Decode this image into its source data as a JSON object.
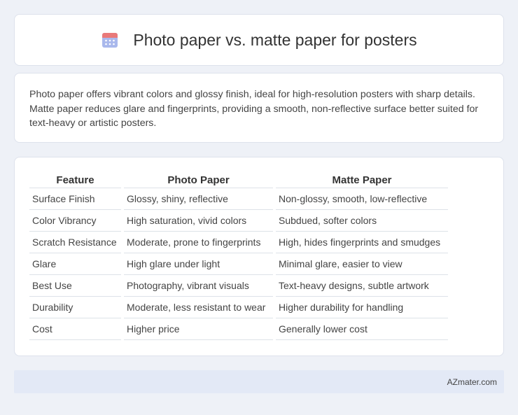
{
  "header": {
    "title": "Photo paper vs. matte paper for posters",
    "icon": "calendar-icon"
  },
  "summary": {
    "text": "Photo paper offers vibrant colors and glossy finish, ideal for high-resolution posters with sharp details. Matte paper reduces glare and fingerprints, providing a smooth, non-reflective surface better suited for text-heavy or artistic posters."
  },
  "table": {
    "headers": [
      "Feature",
      "Photo Paper",
      "Matte Paper"
    ],
    "rows": [
      [
        "Surface Finish",
        "Glossy, shiny, reflective",
        "Non-glossy, smooth, low-reflective"
      ],
      [
        "Color Vibrancy",
        "High saturation, vivid colors",
        "Subdued, softer colors"
      ],
      [
        "Scratch Resistance",
        "Moderate, prone to fingerprints",
        "High, hides fingerprints and smudges"
      ],
      [
        "Glare",
        "High glare under light",
        "Minimal glare, easier to view"
      ],
      [
        "Best Use",
        "Photography, vibrant visuals",
        "Text-heavy designs, subtle artwork"
      ],
      [
        "Durability",
        "Moderate, less resistant to wear",
        "Higher durability for handling"
      ],
      [
        "Cost",
        "Higher price",
        "Generally lower cost"
      ]
    ]
  },
  "footer": {
    "brand": "AZmater.com"
  },
  "colors": {
    "background": "#eef1f7",
    "icon_top": "#e97979",
    "icon_body": "#8fa5e6",
    "footer_bg": "#e3e9f6"
  }
}
